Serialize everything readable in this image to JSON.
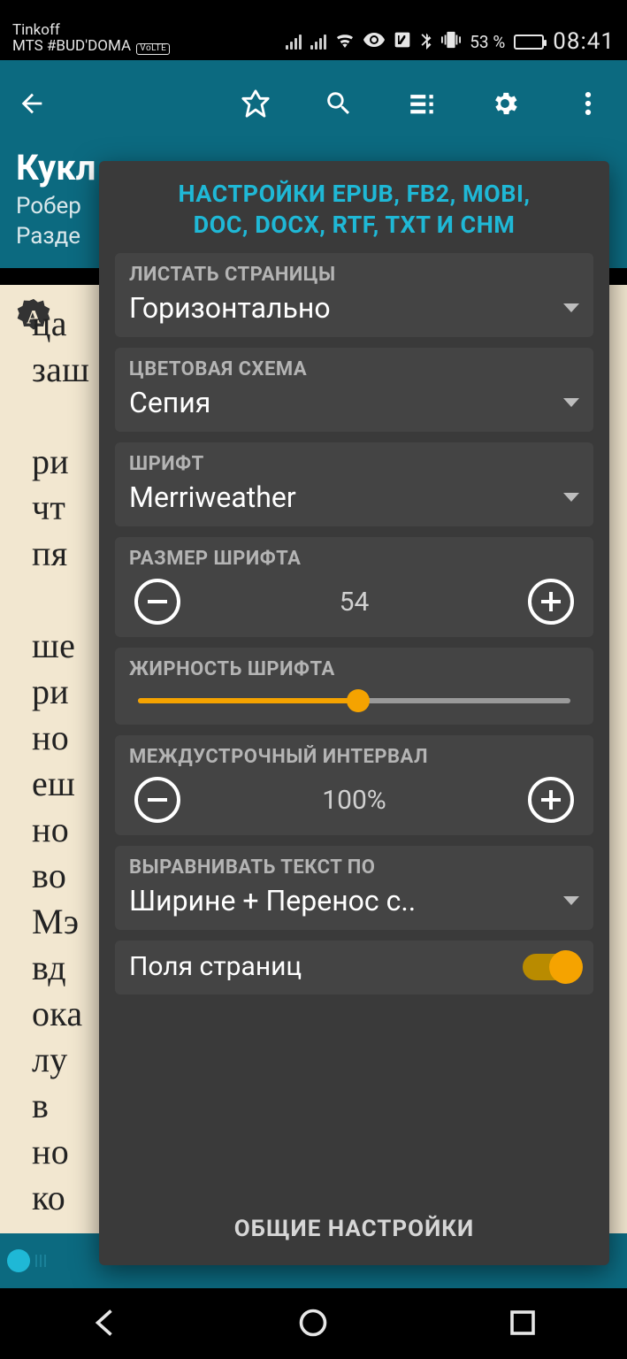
{
  "status_bar": {
    "carrier_top": "Tinkoff",
    "carrier_bottom": "MTS #BUD'DOMA",
    "volte_tag": "VoLTE",
    "battery_percent": "53 %",
    "clock": "08:41",
    "icons": {
      "signal1": "signal-1-icon",
      "signal2": "signal-2-icon",
      "wifi": "wifi-icon",
      "eye": "visibility-icon",
      "nfc": "nfc-icon",
      "bluetooth": "bluetooth-icon",
      "vibrate": "vibrate-icon"
    }
  },
  "toolbar": {
    "back": "back",
    "premium": "premium",
    "search": "search",
    "toc": "contents",
    "settings": "settings",
    "overflow": "more"
  },
  "book": {
    "title": "Кукл",
    "author_line": "Робер",
    "section_line": "Разде"
  },
  "page": {
    "text_snippet": "ца\nзаш\n\nри\nчт\nпя\n\nше\nри\nно\nеш\nно\nво\nМэ\nвд\nока\nлу\nв\nно\nко",
    "autofit_label": "A"
  },
  "settings_panel": {
    "title_line1": "НАСТРОЙКИ EPUB, FB2, MOBI,",
    "title_line2": "DOC, DOCX, RTF, TXT И CHM",
    "page_flip": {
      "label": "ЛИСТАТЬ СТРАНИЦЫ",
      "value": "Горизонтально"
    },
    "color_scheme": {
      "label": "ЦВЕТОВАЯ СХЕМА",
      "value": "Сепия"
    },
    "font_family": {
      "label": "ШРИФТ",
      "value": "Merriweather"
    },
    "font_size": {
      "label": "РАЗМЕР ШРИФТА",
      "value": "54"
    },
    "font_weight": {
      "label": "ЖИРНОСТЬ ШРИФТА",
      "percent": 51
    },
    "line_spacing": {
      "label": "МЕЖДУСТРОЧНЫЙ ИНТЕРВАЛ",
      "value": "100%"
    },
    "text_align": {
      "label": "ВЫРАВНИВАТЬ ТЕКСТ ПО",
      "value": "Ширине + Перенос с.."
    },
    "page_margins": {
      "label": "Поля страниц",
      "on": true
    },
    "footer_button": "ОБЩИЕ НАСТРОЙКИ"
  },
  "nav": {
    "back": "back",
    "home": "home",
    "recent": "recent"
  }
}
